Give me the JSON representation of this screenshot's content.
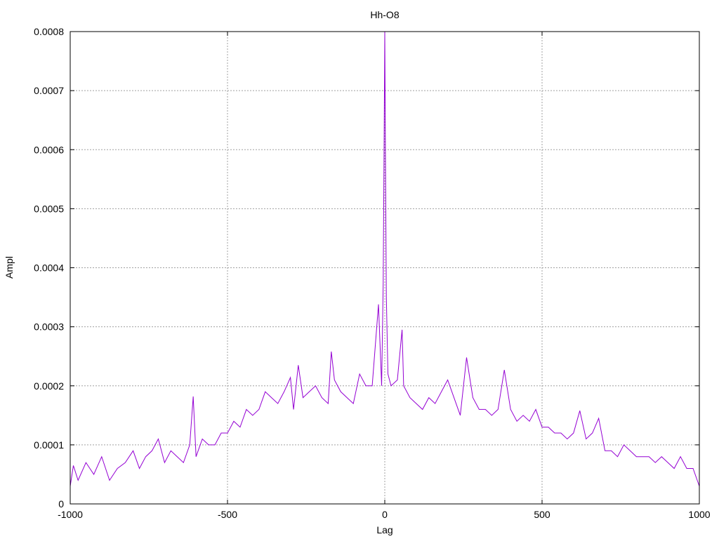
{
  "chart_data": {
    "type": "line",
    "title": "Hh-O8",
    "xlabel": "Lag",
    "ylabel": "Ampl",
    "xlim": [
      -1000,
      1000
    ],
    "ylim": [
      0,
      0.0008
    ],
    "grid": true,
    "x_ticks": [
      -1000,
      -500,
      0,
      500,
      1000
    ],
    "x_tick_labels": [
      "-1000",
      "-500",
      "0",
      "500",
      "1000"
    ],
    "y_ticks": [
      0,
      0.0001,
      0.0002,
      0.0003,
      0.0004,
      0.0005,
      0.0006,
      0.0007,
      0.0008
    ],
    "y_tick_labels": [
      "0",
      "0.0001",
      "0.0002",
      "0.0003",
      "0.0004",
      "0.0005",
      "0.0006",
      "0.0007",
      "0.0008"
    ],
    "series": [
      {
        "color": "#9400d3",
        "x": [
          -1000,
          -990,
          -975,
          -950,
          -925,
          -900,
          -875,
          -850,
          -825,
          -800,
          -780,
          -760,
          -740,
          -720,
          -700,
          -680,
          -660,
          -640,
          -620,
          -609,
          -600,
          -580,
          -560,
          -540,
          -520,
          -500,
          -480,
          -460,
          -440,
          -420,
          -400,
          -380,
          -360,
          -340,
          -320,
          -300,
          -290,
          -275,
          -260,
          -240,
          -220,
          -200,
          -180,
          -170,
          -160,
          -140,
          -120,
          -100,
          -80,
          -60,
          -40,
          -20,
          -10,
          -5,
          -2,
          0,
          2,
          5,
          10,
          20,
          40,
          55,
          60,
          80,
          100,
          120,
          140,
          160,
          180,
          200,
          220,
          240,
          260,
          280,
          300,
          320,
          340,
          360,
          380,
          400,
          420,
          440,
          460,
          480,
          500,
          520,
          540,
          560,
          580,
          600,
          620,
          640,
          660,
          680,
          700,
          720,
          740,
          760,
          780,
          800,
          820,
          840,
          860,
          880,
          900,
          920,
          940,
          960,
          980,
          1000
        ],
        "y": [
          3e-05,
          6.5e-05,
          4e-05,
          7e-05,
          5e-05,
          8e-05,
          4e-05,
          6e-05,
          7e-05,
          9e-05,
          6e-05,
          8e-05,
          9e-05,
          0.00011,
          7e-05,
          9e-05,
          8e-05,
          7e-05,
          0.0001,
          0.000182,
          8e-05,
          0.00011,
          0.0001,
          0.0001,
          0.00012,
          0.00012,
          0.00014,
          0.00013,
          0.00016,
          0.00015,
          0.00016,
          0.00019,
          0.00018,
          0.00017,
          0.00019,
          0.000214,
          0.00016,
          0.000235,
          0.00018,
          0.00019,
          0.0002,
          0.00018,
          0.00017,
          0.000258,
          0.00021,
          0.00019,
          0.00018,
          0.00017,
          0.00022,
          0.0002,
          0.0002,
          0.000338,
          0.0002,
          0.000375,
          0.00062,
          0.0008,
          0.0006,
          0.00035,
          0.00022,
          0.0002,
          0.00021,
          0.000295,
          0.0002,
          0.00018,
          0.00017,
          0.00016,
          0.00018,
          0.00017,
          0.00019,
          0.00021,
          0.00018,
          0.00015,
          0.000248,
          0.00018,
          0.00016,
          0.00016,
          0.00015,
          0.00016,
          0.000227,
          0.00016,
          0.00014,
          0.00015,
          0.00014,
          0.00016,
          0.00013,
          0.00013,
          0.00012,
          0.00012,
          0.00011,
          0.00012,
          0.000158,
          0.00011,
          0.00012,
          0.000145,
          9e-05,
          9e-05,
          8e-05,
          0.0001,
          9e-05,
          8e-05,
          8e-05,
          8e-05,
          7e-05,
          8e-05,
          7e-05,
          6e-05,
          8e-05,
          6e-05,
          6e-05,
          3e-05
        ]
      }
    ]
  }
}
